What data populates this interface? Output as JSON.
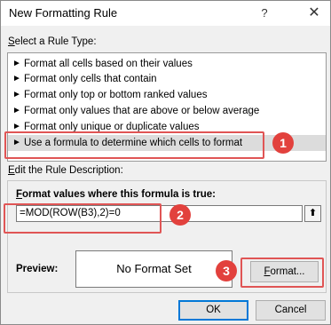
{
  "dialog": {
    "title": "New Formatting Rule",
    "help_glyph": "?",
    "close_glyph": "✕"
  },
  "rule_type": {
    "label_prefix": "S",
    "label_rest": "elect a Rule Type:",
    "items": [
      "Format all cells based on their values",
      "Format only cells that contain",
      "Format only top or bottom ranked values",
      "Format only values that are above or below average",
      "Format only unique or duplicate values",
      "Use a formula to determine which cells to format"
    ],
    "selected_index": 5,
    "arrow_glyph": "►"
  },
  "description": {
    "label_prefix": "E",
    "label_rest": "dit the Rule Description:",
    "formula_label_prefix": "F",
    "formula_label_rest": "ormat values where this formula is true:",
    "formula_value": "=MOD(ROW(B3),2)=0",
    "collapse_glyph": "⬆",
    "preview_label": "Preview:",
    "preview_text": "No Format Set",
    "format_button_prefix": "F",
    "format_button_rest": "ormat..."
  },
  "buttons": {
    "ok": "OK",
    "cancel": "Cancel"
  },
  "callouts": [
    "1",
    "2",
    "3"
  ],
  "colors": {
    "callout": "#e2413d",
    "highlight": "#e05555",
    "ok_border": "#0078d7",
    "selected_row": "#dcdcdc"
  }
}
